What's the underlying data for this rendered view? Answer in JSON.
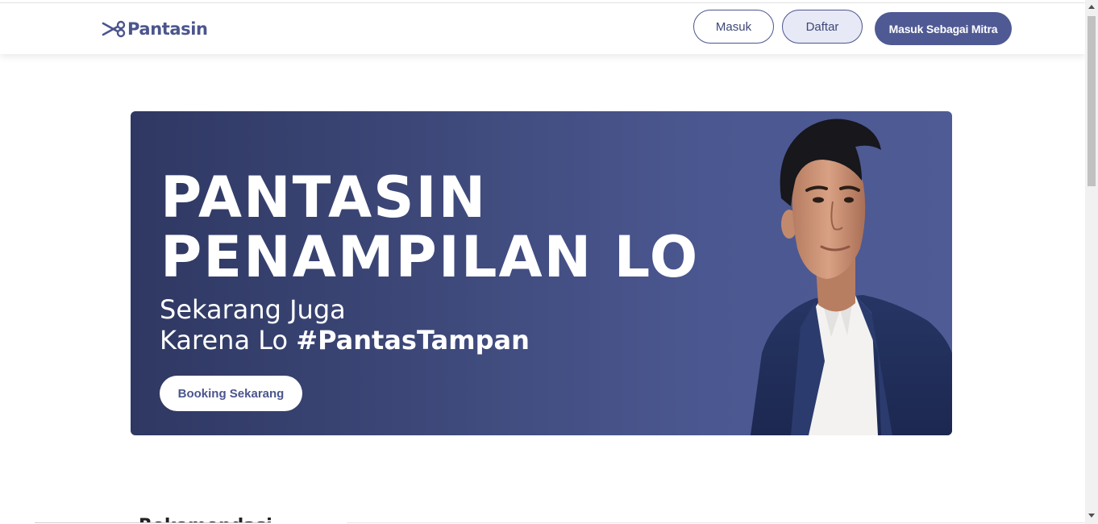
{
  "header": {
    "brand": "Pantasin",
    "login_label": "Masuk",
    "register_label": "Daftar",
    "partner_login_label": "Masuk Sebagai Mitra"
  },
  "hero": {
    "title_line1": "PANTASIN",
    "title_line2": "PENAMPILAN LO",
    "subtitle_line1": "Sekarang Juga",
    "subtitle_line2_prefix": "Karena Lo ",
    "subtitle_line2_hashtag": "#PantasTampan",
    "cta_label": "Booking Sekarang"
  },
  "section_peek": "Rekomendasi",
  "colors": {
    "brand": "#4b558d",
    "hero_dark": "#2f3862",
    "hero_light": "#4f5b95",
    "partner_button": "#4f5a94"
  },
  "icons": {
    "logo": "scissors-icon"
  }
}
